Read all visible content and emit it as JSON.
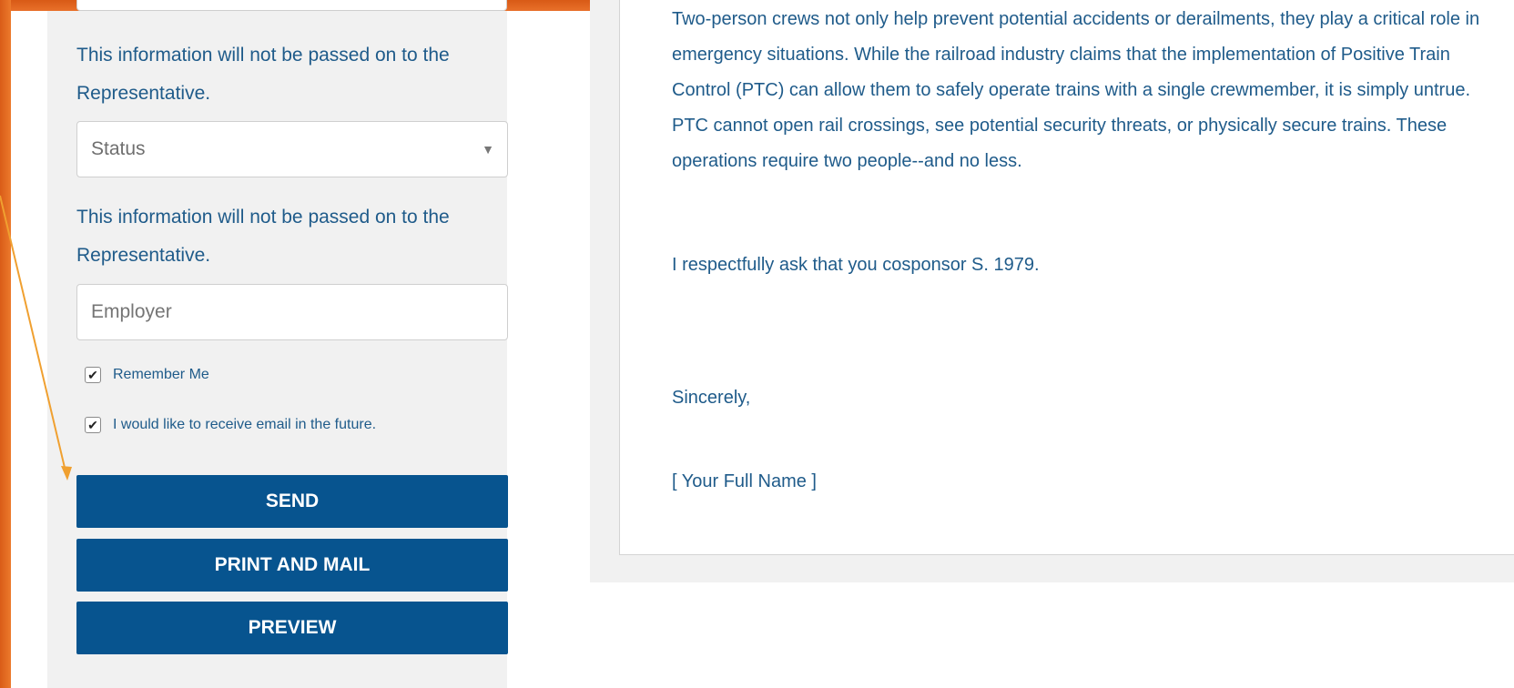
{
  "form": {
    "info_note_1": "This information will not be passed on to the Representative.",
    "status_select": {
      "selected": "Status"
    },
    "info_note_2": "This information will not be passed on to the Representative.",
    "employer_placeholder": "Employer",
    "remember_me": {
      "label": "Remember Me",
      "checked": true
    },
    "email_optin": {
      "label": "I would like to receive email in the future.",
      "checked": true
    },
    "buttons": {
      "send": "SEND",
      "print_mail": "PRINT AND MAIL",
      "preview": "PREVIEW"
    }
  },
  "letter": {
    "paragraph": "Two-person crews not only help prevent potential accidents or derailments, they play a critical role in emergency situations. While the railroad industry claims that the implementation of Positive Train Control (PTC) can allow them to safely operate trains with a single crewmember, it is simply untrue. PTC cannot open rail crossings, see potential security threats, or physically secure trains. These operations require two people--and no less.",
    "request": "I respectfully ask that you cosponsor S. 1979.",
    "closing": "Sincerely,",
    "signature": "[ Your Full Name ]"
  },
  "colors": {
    "accent_orange": "#e8702a",
    "button_blue": "#07548f",
    "text_blue": "#1f5b8a"
  }
}
